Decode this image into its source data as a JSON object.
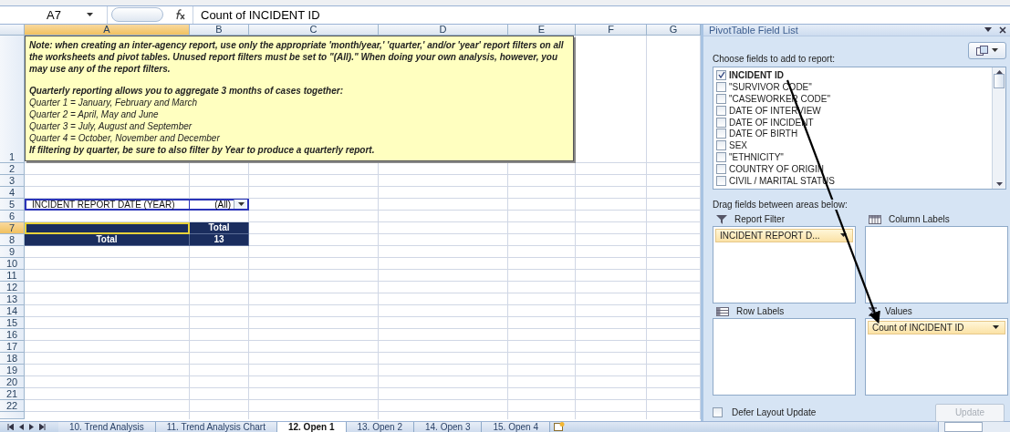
{
  "formula_bar": {
    "name_box": "A7",
    "formula": "Count of INCIDENT ID"
  },
  "sheet": {
    "columns": [
      {
        "label": "A",
        "selected": true
      },
      {
        "label": "B",
        "selected": false
      },
      {
        "label": "C",
        "selected": false
      },
      {
        "label": "D",
        "selected": false
      },
      {
        "label": "E",
        "selected": false
      },
      {
        "label": "F",
        "selected": false
      },
      {
        "label": "G",
        "selected": false
      }
    ],
    "rows": [
      {
        "label": "1",
        "selected": false
      },
      {
        "label": "2",
        "selected": false
      },
      {
        "label": "3",
        "selected": false
      },
      {
        "label": "4",
        "selected": false
      },
      {
        "label": "5",
        "selected": false
      },
      {
        "label": "6",
        "selected": false
      },
      {
        "label": "7",
        "selected": true
      },
      {
        "label": "8",
        "selected": false
      },
      {
        "label": "9",
        "selected": false
      },
      {
        "label": "10",
        "selected": false
      },
      {
        "label": "11",
        "selected": false
      },
      {
        "label": "12",
        "selected": false
      },
      {
        "label": "13",
        "selected": false
      },
      {
        "label": "14",
        "selected": false
      },
      {
        "label": "15",
        "selected": false
      },
      {
        "label": "16",
        "selected": false
      },
      {
        "label": "17",
        "selected": false
      },
      {
        "label": "18",
        "selected": false
      },
      {
        "label": "19",
        "selected": false
      },
      {
        "label": "20",
        "selected": false
      },
      {
        "label": "21",
        "selected": false
      },
      {
        "label": "22",
        "selected": false
      }
    ],
    "note": [
      {
        "kind": "heading",
        "text": "Note: when creating an inter-agency report, use only the appropriate 'month/year,' 'quarter,' and/or 'year' report filters on all the worksheets and pivot tables.  Unused report filters must be set to \"(All).\" When doing your own analysis, however, you may use any of the report filters."
      },
      {
        "kind": "gap"
      },
      {
        "kind": "heading",
        "text": "Quarterly reporting allows you to aggregate 3 months of cases together:"
      },
      {
        "kind": "item",
        "text": "Quarter 1 = January, February and March"
      },
      {
        "kind": "item",
        "text": "Quarter 2 = April, May and June"
      },
      {
        "kind": "item",
        "text": "Quarter 3 = July, August and September"
      },
      {
        "kind": "item",
        "text": "Quarter 4 = October, November and December"
      },
      {
        "kind": "heading",
        "text": "If filtering by quarter, be sure to also filter by Year to produce a quarterly report."
      }
    ],
    "filter": {
      "label": "INCIDENT REPORT DATE (YEAR)",
      "value": "(All)"
    },
    "pivot": {
      "column_header": "Total",
      "total_label": "Total",
      "total_value": "13"
    }
  },
  "sheet_tabs": [
    {
      "label": "10. Trend Analysis",
      "selected": false
    },
    {
      "label": "11. Trend Analysis Chart",
      "selected": false
    },
    {
      "label": "12. Open 1",
      "selected": true
    },
    {
      "label": "13. Open 2",
      "selected": false
    },
    {
      "label": "14. Open 3",
      "selected": false
    },
    {
      "label": "15. Open 4",
      "selected": false
    }
  ],
  "pivot_field_list": {
    "title": "PivotTable Field List",
    "choose_label": "Choose fields to add to report:",
    "fields": [
      {
        "label": "INCIDENT ID",
        "checked": true
      },
      {
        "label": "\"SURVIVOR CODE\"",
        "checked": false
      },
      {
        "label": "\"CASEWORKER CODE\"",
        "checked": false
      },
      {
        "label": "DATE OF INTERVIEW",
        "checked": false
      },
      {
        "label": "DATE OF INCIDENT",
        "checked": false
      },
      {
        "label": "DATE OF BIRTH",
        "checked": false
      },
      {
        "label": "SEX",
        "checked": false
      },
      {
        "label": "\"ETHNICITY\"",
        "checked": false
      },
      {
        "label": "COUNTRY OF ORIGIN",
        "checked": false
      },
      {
        "label": "CIVIL / MARITAL STATUS",
        "checked": false
      }
    ],
    "drag_label": "Drag fields between areas below:",
    "areas": [
      {
        "kind": "filter",
        "label": "Report Filter",
        "items": [
          "INCIDENT REPORT D..."
        ]
      },
      {
        "kind": "columns",
        "label": "Column Labels"
      },
      {
        "kind": "rows",
        "label": "Row Labels"
      },
      {
        "kind": "values",
        "label": "Values",
        "items": [
          "Count of INCIDENT ID"
        ]
      }
    ],
    "defer": {
      "label": "Defer Layout Update",
      "checked": false
    },
    "update_button": {
      "label": "Update",
      "disabled": true
    }
  }
}
